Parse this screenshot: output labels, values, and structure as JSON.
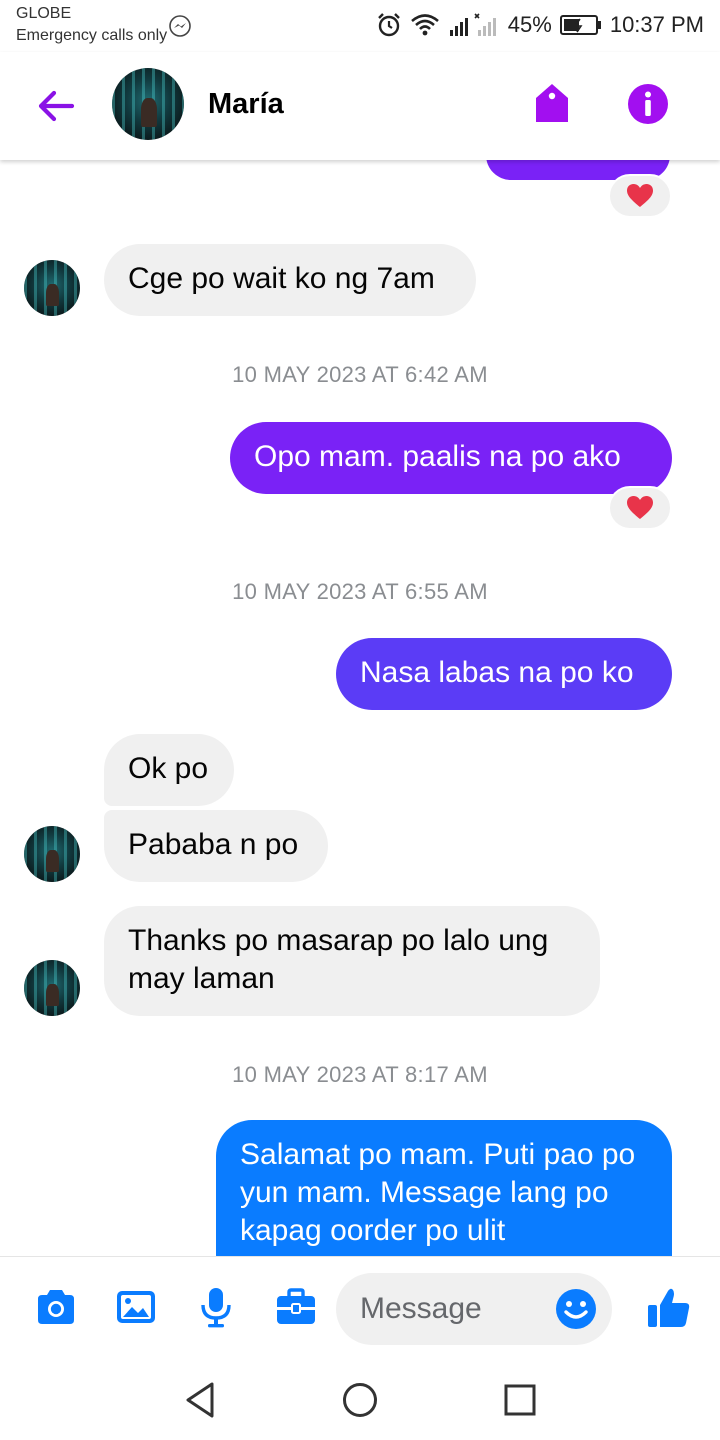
{
  "status_bar": {
    "carrier": "GLOBE",
    "carrier_sub": "Emergency calls only",
    "battery": "45%",
    "time": "10:37 PM"
  },
  "header": {
    "contact_name": "María"
  },
  "chat": {
    "msg_top_partial": "",
    "msg1": "Cge po wait ko ng 7am",
    "ts1": "10 MAY 2023 AT 6:42 AM",
    "msg2": "Opo mam.  paalis na po ako",
    "ts2": "10 MAY 2023 AT 6:55 AM",
    "msg3": "Nasa labas na po ko",
    "msg4": "Ok po",
    "msg5": "Pababa n po",
    "msg6": "Thanks po masarap po lalo ung may laman",
    "ts3": "10 MAY 2023 AT 8:17 AM",
    "msg7": "Salamat po mam. Puti pao po yun mam. Message lang po kapag oorder po  ulit"
  },
  "composer": {
    "placeholder": "Message"
  },
  "colors": {
    "accent_purple": "#8a12e6",
    "bubble_purple": "#7a22f6",
    "bubble_violet": "#5b3cf6",
    "bubble_blue": "#0a7cff",
    "incoming": "#f0f0f0",
    "composer_blue": "#0a7cff"
  },
  "icons": [
    "messenger-icon",
    "alarm-icon",
    "wifi-icon",
    "signal-icon",
    "battery-icon",
    "back-arrow-icon",
    "tag-icon",
    "info-icon",
    "heart-icon",
    "camera-icon",
    "image-icon",
    "mic-icon",
    "briefcase-icon",
    "smile-icon",
    "thumbs-up-icon",
    "nav-back-icon",
    "nav-home-icon",
    "nav-recents-icon"
  ]
}
